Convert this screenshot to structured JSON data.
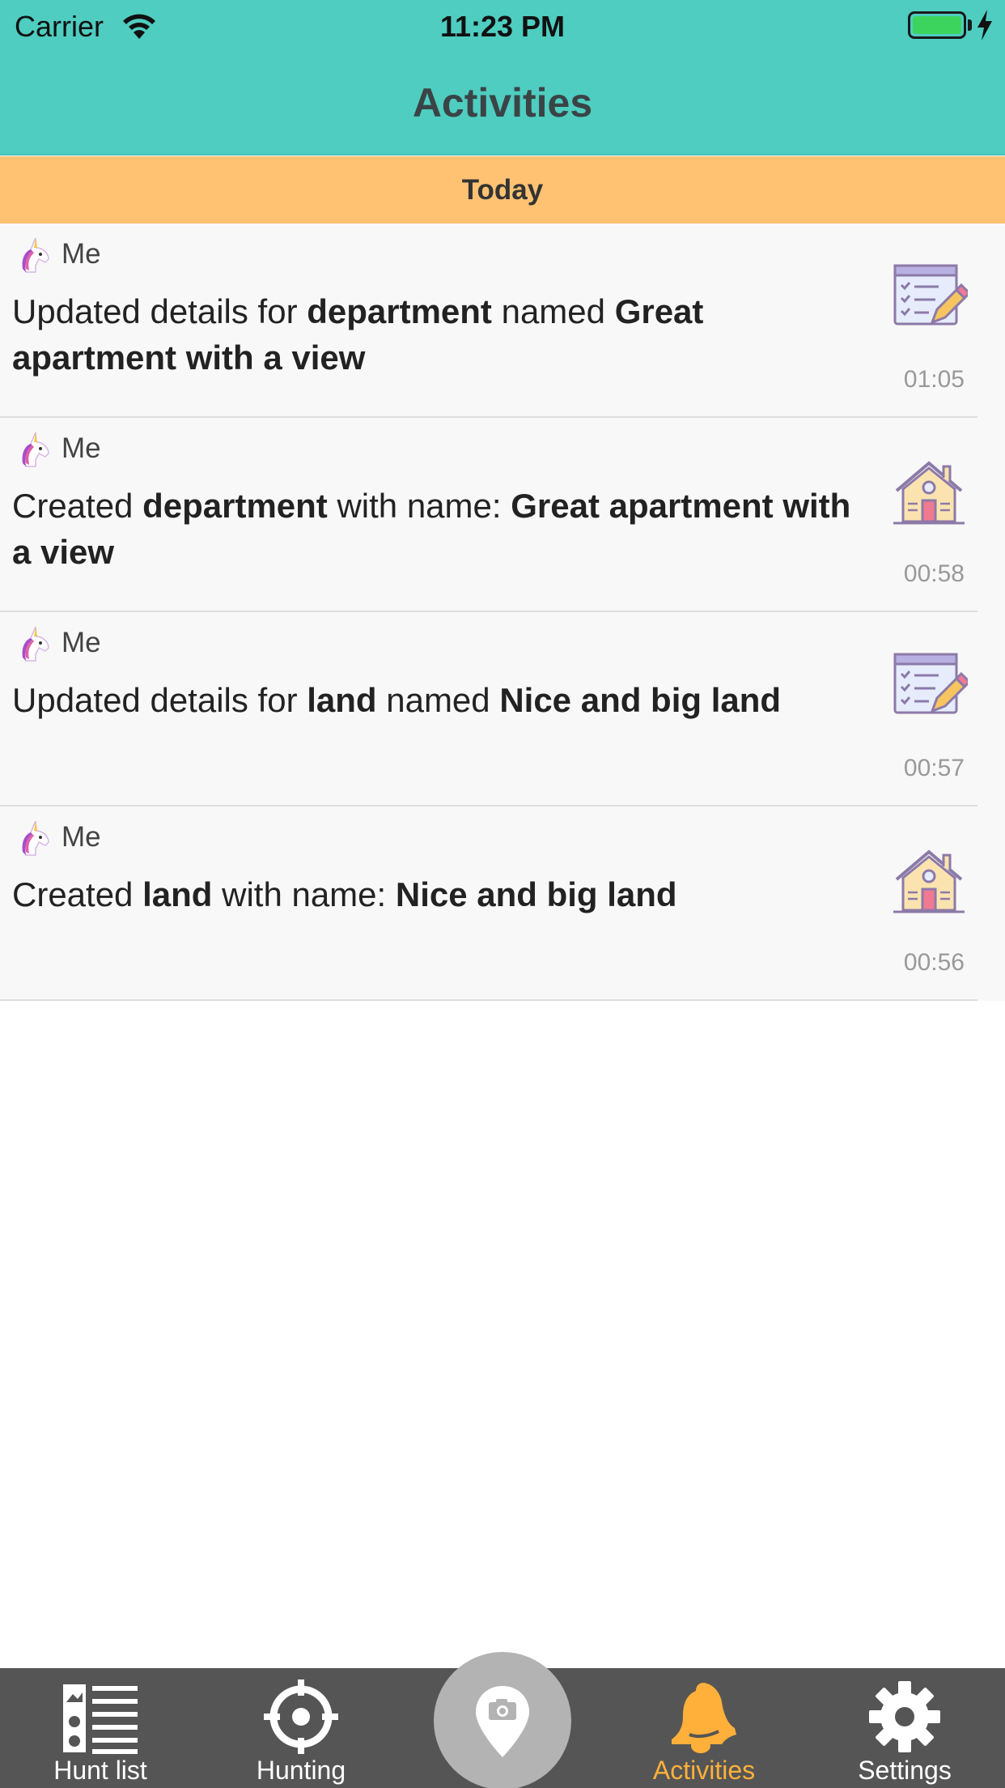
{
  "status_bar": {
    "carrier": "Carrier",
    "time": "11:23 PM",
    "battery_color": "#3dd45e"
  },
  "header": {
    "title": "Activities",
    "background": "#4ecdc0"
  },
  "section": {
    "label": "Today",
    "background": "#fec272"
  },
  "activities": [
    {
      "author": "Me",
      "parts": [
        "Updated details for ",
        "department",
        " named ",
        "Great apartment with a view"
      ],
      "time": "01:05",
      "icon": "edit-form-icon"
    },
    {
      "author": "Me",
      "parts": [
        "Created ",
        "department",
        " with name: ",
        "Great apartment with a view"
      ],
      "time": "00:58",
      "icon": "house-icon"
    },
    {
      "author": "Me",
      "parts": [
        "Updated details for ",
        "land",
        " named ",
        "Nice and big land"
      ],
      "time": "00:57",
      "icon": "edit-form-icon"
    },
    {
      "author": "Me",
      "parts": [
        "Created ",
        "land",
        " with name: ",
        "Nice and big land"
      ],
      "time": "00:56",
      "icon": "house-icon"
    }
  ],
  "tabbar": {
    "items": [
      {
        "label": "Hunt list",
        "icon": "hunt-list-icon"
      },
      {
        "label": "Hunting",
        "icon": "crosshair-icon"
      },
      {
        "label": "Activities",
        "icon": "bell-icon",
        "active": true
      },
      {
        "label": "Settings",
        "icon": "gear-icon"
      }
    ],
    "center_icon": "camera-pin-icon",
    "active_color": "#ffb03a"
  }
}
